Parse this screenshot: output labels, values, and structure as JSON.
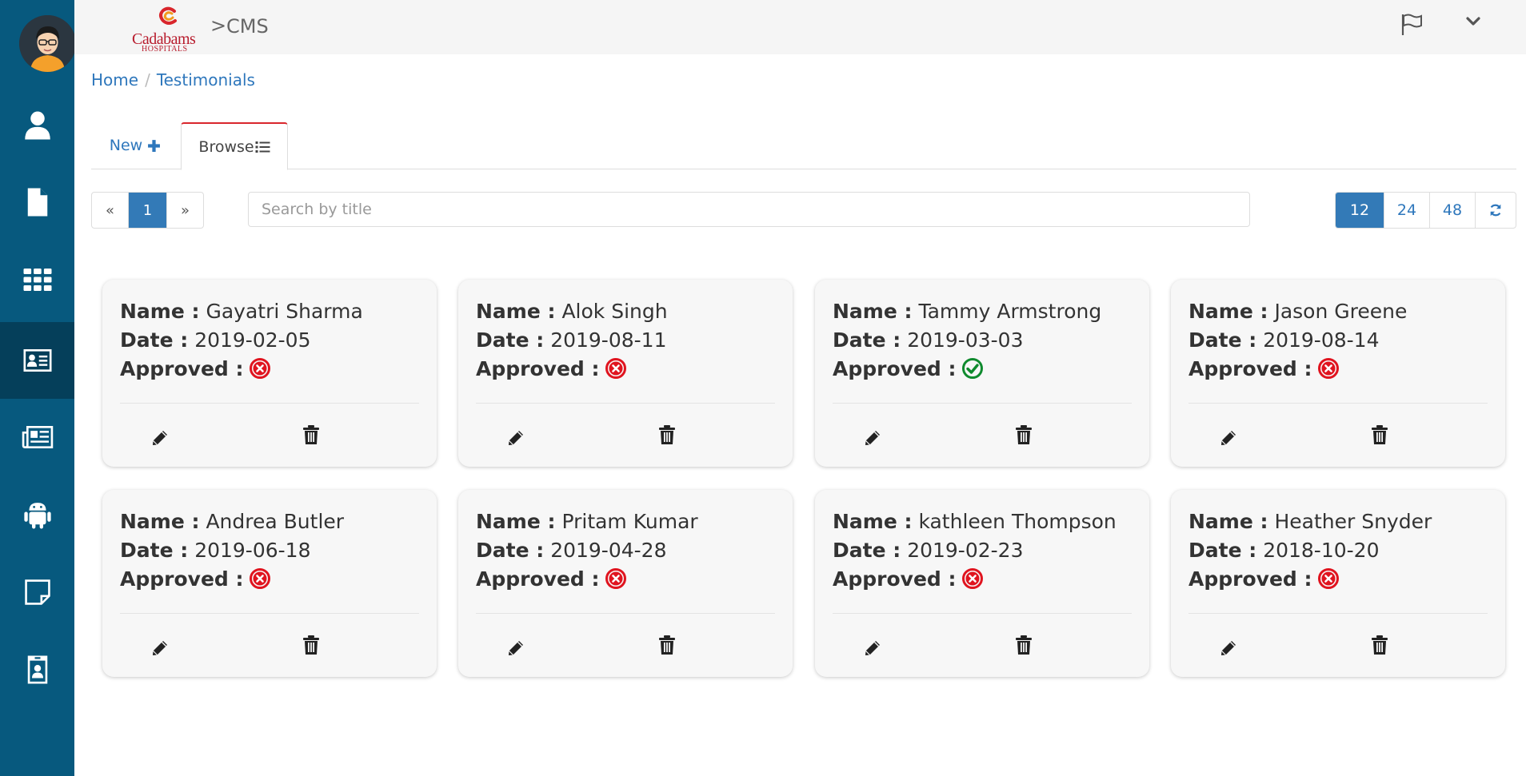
{
  "header": {
    "logo_text": "Cadabams",
    "logo_subtext": "HOSPITALS",
    "separator": ">",
    "app_title": "CMS"
  },
  "sidebar": {
    "items": [
      {
        "icon": "user-icon"
      },
      {
        "icon": "file-icon"
      },
      {
        "icon": "grid-icon"
      },
      {
        "icon": "id-card-icon",
        "active": true
      },
      {
        "icon": "newspaper-icon"
      },
      {
        "icon": "android-icon"
      },
      {
        "icon": "sticky-note-icon"
      },
      {
        "icon": "id-badge-icon"
      }
    ]
  },
  "breadcrumb": {
    "home": "Home",
    "separator": "/",
    "current": "Testimonials"
  },
  "tabs": {
    "new_label": "New",
    "browse_label": "Browse"
  },
  "pagination": {
    "prev": "«",
    "current": "1",
    "next": "»"
  },
  "search": {
    "placeholder": "Search by title"
  },
  "per_page": {
    "options": [
      "12",
      "24",
      "48"
    ],
    "selected": "12"
  },
  "labels": {
    "name": "Name :",
    "date": "Date :",
    "approved": "Approved :"
  },
  "colors": {
    "sidebar": "#07597e",
    "accent": "#337ab7",
    "approved_yes": "#0f8a2e",
    "approved_no": "#e0141f"
  },
  "testimonials": [
    {
      "name": "Gayatri Sharma",
      "date": "2019-02-05",
      "approved": false
    },
    {
      "name": "Alok Singh",
      "date": "2019-08-11",
      "approved": false
    },
    {
      "name": "Tammy Armstrong",
      "date": "2019-03-03",
      "approved": true
    },
    {
      "name": "Jason Greene",
      "date": "2019-08-14",
      "approved": false
    },
    {
      "name": "Andrea Butler",
      "date": "2019-06-18",
      "approved": false
    },
    {
      "name": "Pritam Kumar",
      "date": "2019-04-28",
      "approved": false
    },
    {
      "name": "kathleen Thompson",
      "date": "2019-02-23",
      "approved": false
    },
    {
      "name": "Heather Snyder",
      "date": "2018-10-20",
      "approved": false
    }
  ]
}
